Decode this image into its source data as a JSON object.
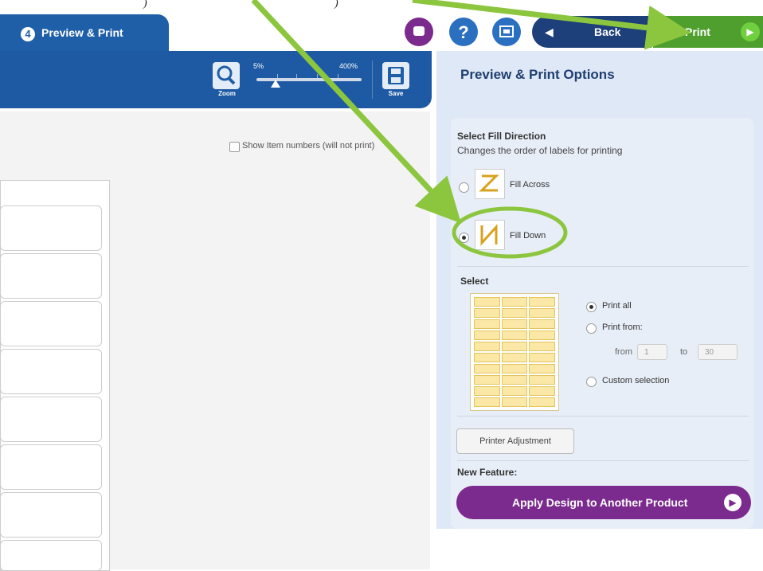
{
  "header": {
    "step_number": "4",
    "step_label": "Preview & Print",
    "back_label": "Back",
    "print_label": "Print"
  },
  "toolbar": {
    "zoom_label": "Zoom",
    "zoom_min": "5%",
    "zoom_max": "400%",
    "save_label": "Save"
  },
  "canvas": {
    "show_numbers_label": "Show Item numbers (will not print)"
  },
  "panel": {
    "title": "Preview & Print Options",
    "fill_direction_title": "Select Fill Direction",
    "fill_direction_sub": "Changes the order of labels for printing",
    "fill_across_label": "Fill Across",
    "fill_down_label": "Fill Down",
    "fill_down_selected": true,
    "select_title": "Select",
    "print_all_label": "Print all",
    "print_from_label": "Print from:",
    "from_label": "from",
    "from_value": "1",
    "to_label": "to",
    "to_value": "30",
    "custom_selection_label": "Custom selection",
    "printer_adjustment_label": "Printer Adjustment",
    "new_feature_label": "New Feature:",
    "apply_design_label": "Apply Design to Another Product"
  },
  "colors": {
    "tab_blue": "#1f5fa8",
    "print_green": "#4e9f2e",
    "apply_purple": "#7b2a8e",
    "annotation_green": "#8cc63f"
  }
}
